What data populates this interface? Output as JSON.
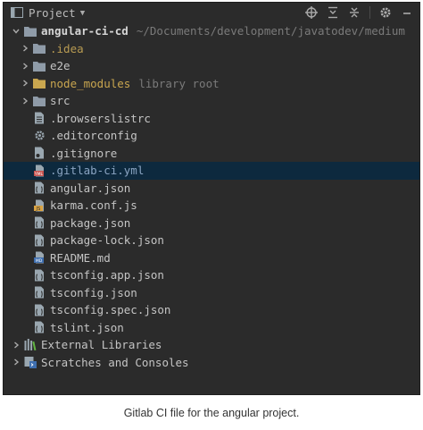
{
  "colors": {
    "panel_bg": "#2b2b2b",
    "selected_bg": "#0d293e",
    "folder": "#8f9ba8",
    "excluded_folder": "#c9a64f",
    "caption": "#333333"
  },
  "header": {
    "title": "Project",
    "icons": [
      "project-panel-icon",
      "crosshair-icon",
      "expand-all-icon",
      "collapse-all-icon",
      "gear-icon",
      "minimize-icon"
    ]
  },
  "tree": {
    "root": {
      "name": "angular-ci-cd",
      "path": "~/Documents/development/javatodev/medium"
    },
    "folders": [
      {
        "name": ".idea"
      },
      {
        "name": "e2e"
      },
      {
        "name": "node_modules",
        "hint": "library root"
      },
      {
        "name": "src"
      }
    ],
    "files": [
      {
        "name": ".browserslistrc"
      },
      {
        "name": ".editorconfig"
      },
      {
        "name": ".gitignore"
      },
      {
        "name": ".gitlab-ci.yml",
        "selected": true
      },
      {
        "name": "angular.json"
      },
      {
        "name": "karma.conf.js"
      },
      {
        "name": "package.json"
      },
      {
        "name": "package-lock.json"
      },
      {
        "name": "README.md"
      },
      {
        "name": "tsconfig.app.json"
      },
      {
        "name": "tsconfig.json"
      },
      {
        "name": "tsconfig.spec.json"
      },
      {
        "name": "tslint.json"
      }
    ],
    "extras": [
      {
        "name": "External Libraries"
      },
      {
        "name": "Scratches and Consoles"
      }
    ]
  },
  "caption": "Gitlab CI file for the angular project."
}
